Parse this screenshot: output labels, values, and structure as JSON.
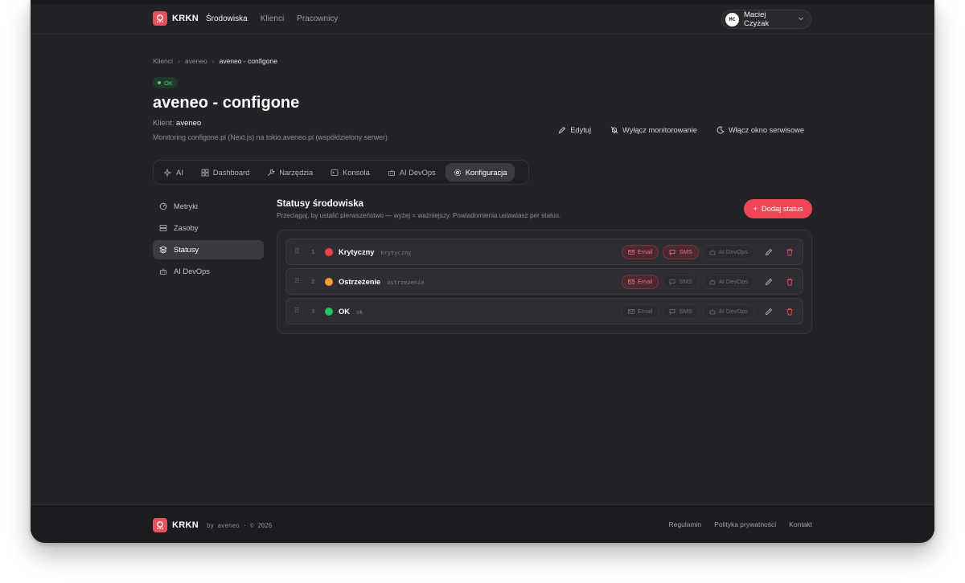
{
  "app": {
    "name": "KRKN"
  },
  "nav": {
    "links": [
      "Środowiska",
      "Klienci",
      "Pracownicy"
    ],
    "active_index": 0
  },
  "user": {
    "initials": "MC",
    "name": "Maciej Czyżak"
  },
  "breadcrumb": [
    "Klienci",
    "aveneo",
    "aveneo - configone"
  ],
  "status_badge": "OK",
  "page": {
    "title": "aveneo - configone",
    "client_label": "Klient:",
    "client_name": "aveneo",
    "description": "Monitoring configone.pl (Next.js) na tokio.aveneo.pl (współdzielony serwer)"
  },
  "actions": {
    "edit": "Edytuj",
    "disable_monitoring": "Wyłącz monitorowanie",
    "enable_maintenance": "Włącz okno serwisowe"
  },
  "tabs": [
    {
      "label": "AI",
      "icon": "sparkles-icon"
    },
    {
      "label": "Dashboard",
      "icon": "dashboard-icon"
    },
    {
      "label": "Narzędzia",
      "icon": "wrench-icon"
    },
    {
      "label": "Konsola",
      "icon": "terminal-icon"
    },
    {
      "label": "AI DevOps",
      "icon": "robot-icon"
    },
    {
      "label": "Konfiguracja",
      "icon": "gear-icon"
    }
  ],
  "active_tab": "Konfiguracja",
  "sidebar": {
    "items": [
      {
        "label": "Metryki",
        "icon": "gauge-icon"
      },
      {
        "label": "Zasoby",
        "icon": "server-icon"
      },
      {
        "label": "Statusy",
        "icon": "layers-icon"
      },
      {
        "label": "AI DevOps",
        "icon": "robot-icon"
      }
    ],
    "active": "Statusy"
  },
  "statuses": {
    "title": "Statusy środowiska",
    "subtitle": "Przeciągaj, by ustalić pierwszeństwo — wyżej = ważniejszy. Powiadomienia ustawiasz per status.",
    "add_label": "Dodaj status",
    "channel_labels": {
      "email": "Email",
      "sms": "SMS",
      "ai": "AI DevOps"
    },
    "rows": [
      {
        "index": "1",
        "name": "Krytyczny",
        "key": "krytyczny",
        "color": "#ef4444",
        "email": true,
        "sms": true,
        "ai": false
      },
      {
        "index": "2",
        "name": "Ostrzeżenie",
        "key": "ostrzezenie",
        "color": "#f59e2e",
        "email": true,
        "sms": false,
        "ai": false
      },
      {
        "index": "3",
        "name": "OK",
        "key": "ok",
        "color": "#22c55e",
        "email": false,
        "sms": false,
        "ai": false
      }
    ]
  },
  "footer": {
    "brand": "KRKN",
    "byline": "by aveneo · © 2026",
    "links": [
      "Regulamin",
      "Polityka prywatności",
      "Kontakt"
    ]
  },
  "colors": {
    "accent": "#ef4656",
    "ok": "#4ccf7a",
    "bg": "#222227"
  }
}
